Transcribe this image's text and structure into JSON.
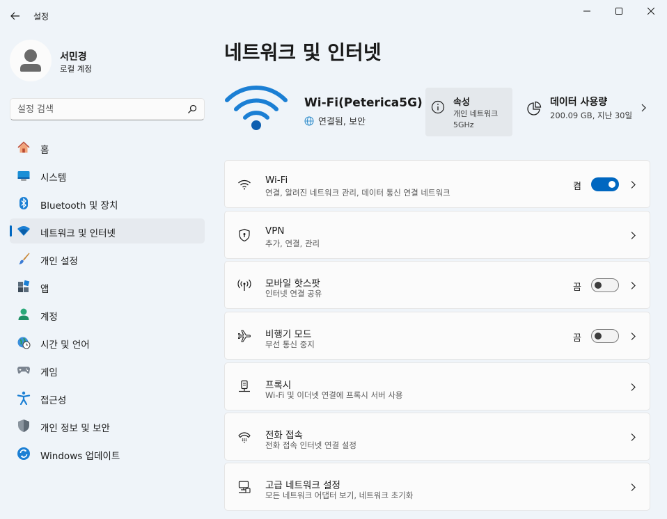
{
  "window": {
    "title": "설정"
  },
  "profile": {
    "name": "서민경",
    "account_type": "로컬 계정"
  },
  "search": {
    "placeholder": "설정 검색",
    "value": ""
  },
  "sidebar": {
    "items": [
      {
        "label": "홈",
        "icon": "home-icon"
      },
      {
        "label": "시스템",
        "icon": "system-icon"
      },
      {
        "label": "Bluetooth 및 장치",
        "icon": "bluetooth-icon"
      },
      {
        "label": "네트워크 및 인터넷",
        "icon": "network-icon",
        "active": true
      },
      {
        "label": "개인 설정",
        "icon": "brush-icon"
      },
      {
        "label": "앱",
        "icon": "apps-icon"
      },
      {
        "label": "계정",
        "icon": "account-icon"
      },
      {
        "label": "시간 및 언어",
        "icon": "time-language-icon"
      },
      {
        "label": "게임",
        "icon": "gaming-icon"
      },
      {
        "label": "접근성",
        "icon": "accessibility-icon"
      },
      {
        "label": "개인 정보 및 보안",
        "icon": "shield-icon"
      },
      {
        "label": "Windows 업데이트",
        "icon": "update-icon"
      }
    ]
  },
  "main": {
    "title": "네트워크 및 인터넷",
    "connection": {
      "name": "Wi-Fi(Peterica5G)",
      "status": "연결됨, 보안"
    },
    "properties": {
      "title": "속성",
      "line1": "개인 네트워크",
      "line2": "5GHz"
    },
    "data_usage": {
      "title": "데이터 사용량",
      "detail": "200.09 GB, 지난 30일"
    },
    "settings": [
      {
        "title": "Wi-Fi",
        "subtitle": "연결, 알려진 네트워크 관리, 데이터 통신 연결 네트워크",
        "icon": "wifi-icon",
        "toggle": "켬",
        "on": true
      },
      {
        "title": "VPN",
        "subtitle": "추가, 연결, 관리",
        "icon": "vpn-shield-icon"
      },
      {
        "title": "모바일 핫스팟",
        "subtitle": "인터넷 연결 공유",
        "icon": "hotspot-icon",
        "toggle": "끔",
        "on": false
      },
      {
        "title": "비행기 모드",
        "subtitle": "무선 통신 중지",
        "icon": "airplane-icon",
        "toggle": "끔",
        "on": false
      },
      {
        "title": "프록시",
        "subtitle": "Wi-Fi 및 이더넷 연결에 프록시 서버 사용",
        "icon": "proxy-icon"
      },
      {
        "title": "전화 접속",
        "subtitle": "전화 접속 인터넷 연결 설정",
        "icon": "dialup-icon"
      },
      {
        "title": "고급 네트워크 설정",
        "subtitle": "모든 네트워크 어댑터 보기, 네트워크 초기화",
        "icon": "advanced-network-icon"
      }
    ]
  },
  "colors": {
    "accent": "#0067c0",
    "background": "#eff4f9",
    "card": "#fbfbfb"
  }
}
